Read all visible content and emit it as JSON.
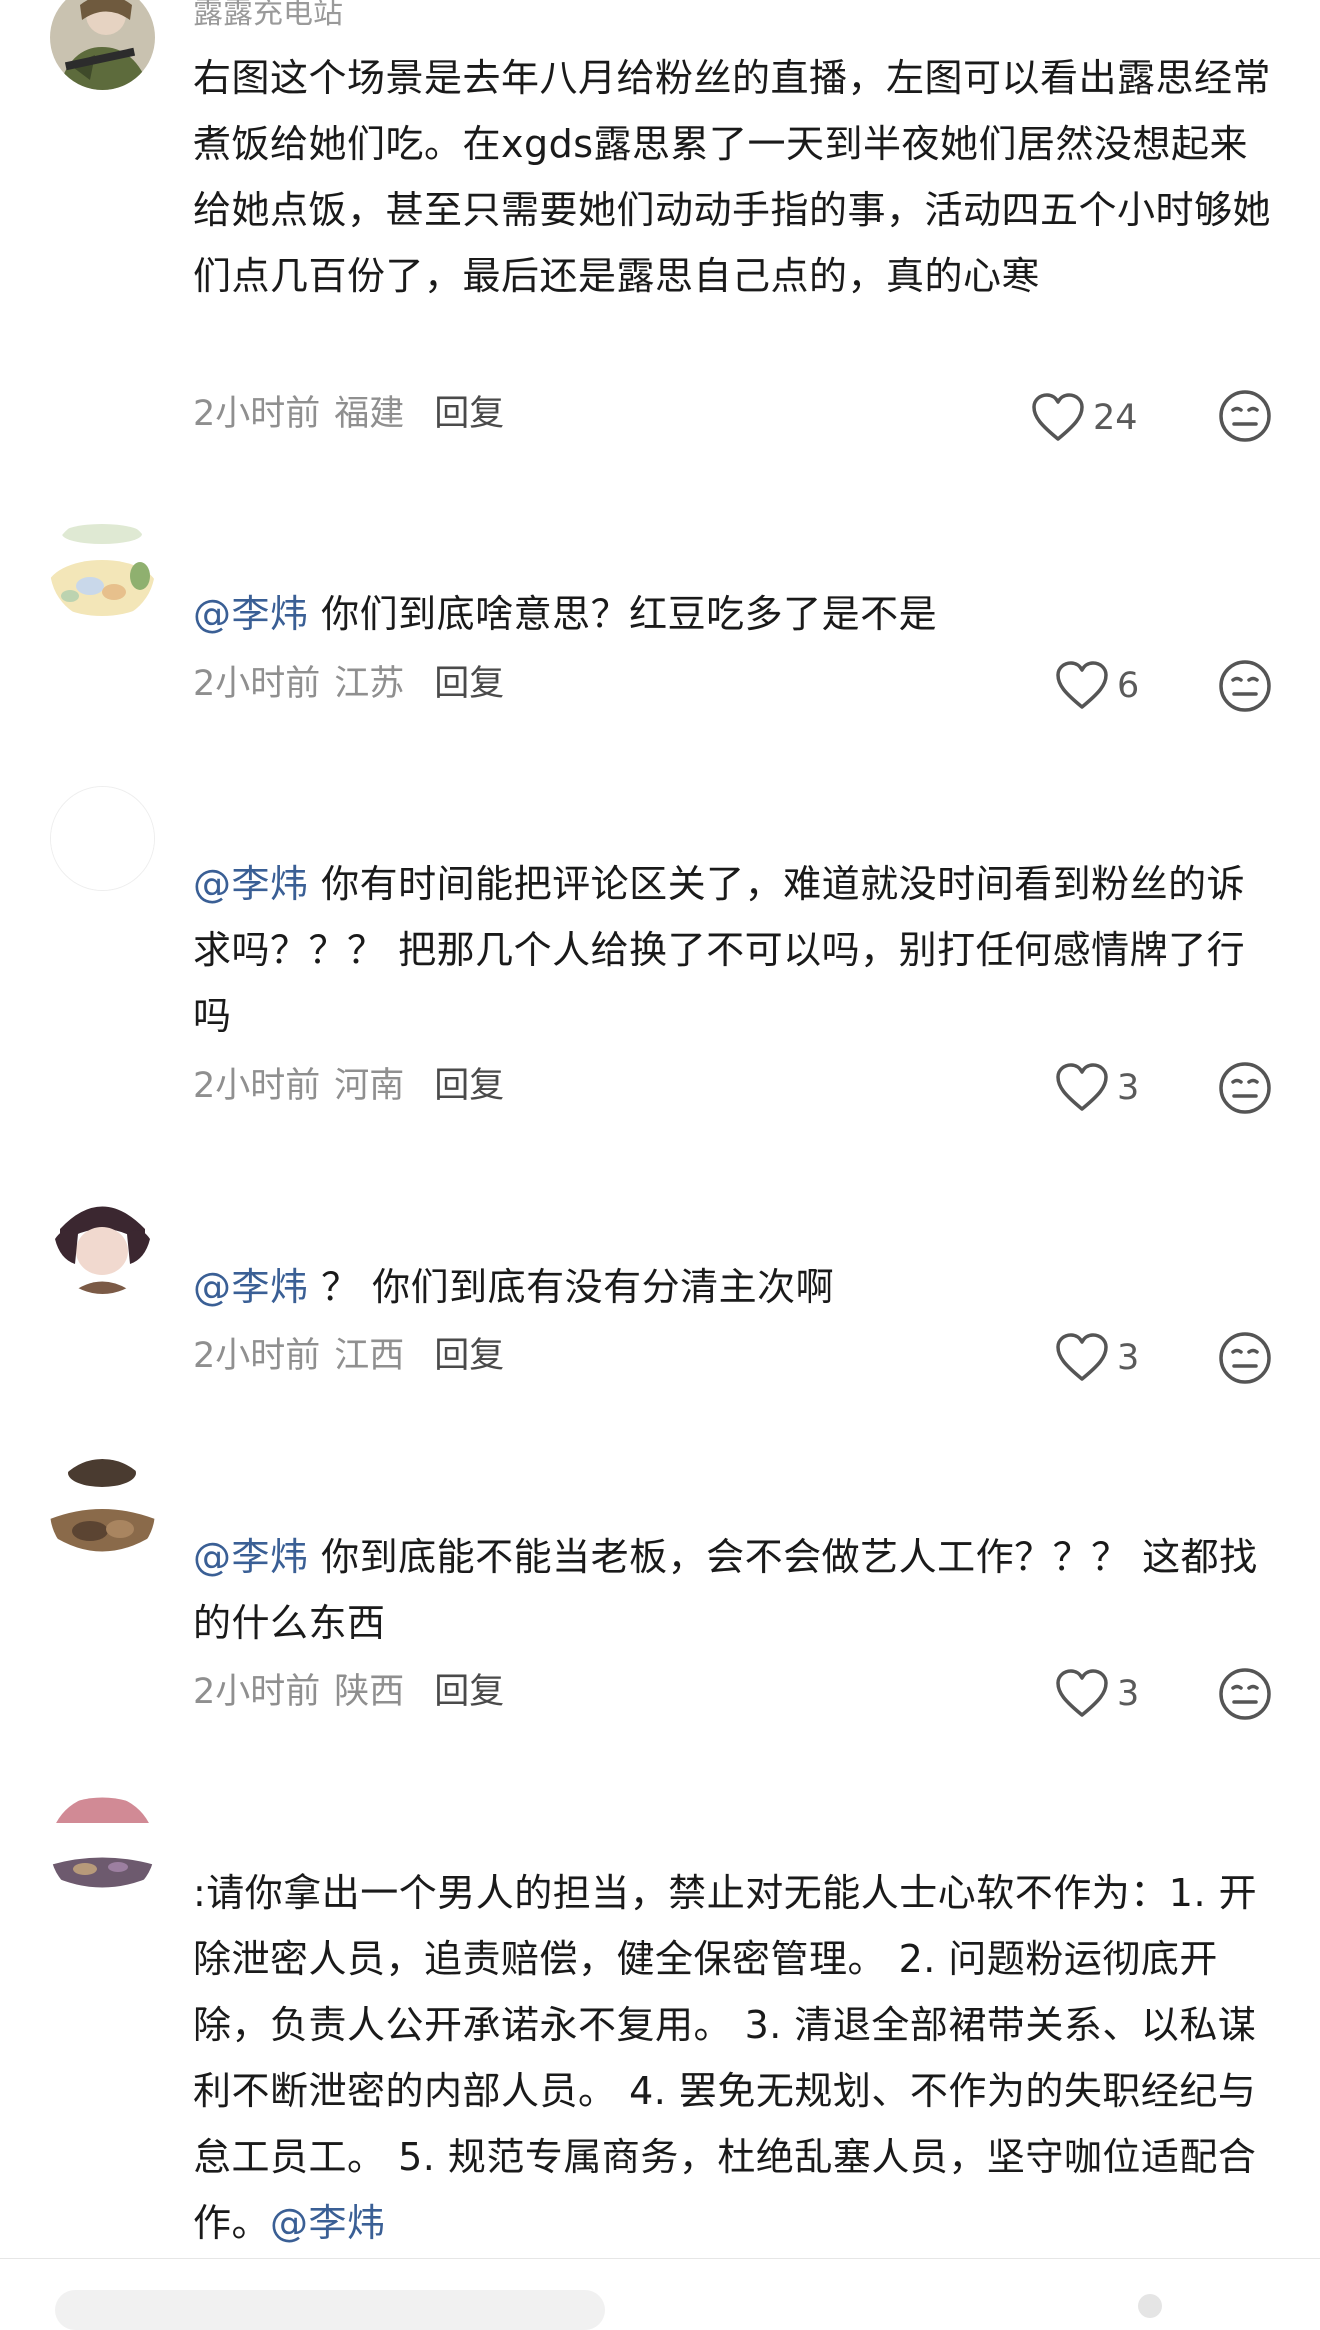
{
  "comments": [
    {
      "name": "露露充电站",
      "segments": [
        {
          "text": "右图这个场景是去年八月给粉丝的直播，左图可以看出露思经常煮饭给她们吃。在xgds露思累了一天到半夜她们居然没想起来给她点饭，甚至只需要她们动动手指的事，活动四五个小时够她们点几百份了，最后还是露思自己点的，真的心寒",
          "mention": false
        }
      ],
      "time": "2小时前",
      "region": "福建",
      "reply_label": "回复",
      "likes": "24"
    },
    {
      "name": "",
      "segments": [
        {
          "text": "@李炜",
          "mention": true
        },
        {
          "text": " 你们到底啥意思？红豆吃多了是不是",
          "mention": false
        }
      ],
      "time": "2小时前",
      "region": "江苏",
      "reply_label": "回复",
      "likes": "6"
    },
    {
      "name": "",
      "segments": [
        {
          "text": "@李炜",
          "mention": true
        },
        {
          "text": " 你有时间能把评论区关了，难道就没时间看到粉丝的诉求吗？？？ 把那几个人给换了不可以吗，别打任何感情牌了行吗",
          "mention": false
        }
      ],
      "time": "2小时前",
      "region": "河南",
      "reply_label": "回复",
      "likes": "3"
    },
    {
      "name": "",
      "segments": [
        {
          "text": "@李炜",
          "mention": true
        },
        {
          "text": " ？ 你们到底有没有分清主次啊",
          "mention": false
        }
      ],
      "time": "2小时前",
      "region": "江西",
      "reply_label": "回复",
      "likes": "3"
    },
    {
      "name": "",
      "segments": [
        {
          "text": "@李炜",
          "mention": true
        },
        {
          "text": " 你到底能不能当老板，会不会做艺人工作？？？ 这都找的什么东西",
          "mention": false
        }
      ],
      "time": "2小时前",
      "region": "陕西",
      "reply_label": "回复",
      "likes": "3"
    },
    {
      "name": "",
      "segments": [
        {
          "text": ":请你拿出一个男人的担当，禁止对无能人士心软不作为：1. 开除泄密人员，追责赔偿，健全保密管理。 2. 问题粉运彻底开除，负责人公开承诺永不复用。 3. 清退全部裙带关系、以私谋利不断泄密的内部人员。 4. 罢免无规划、不作为的失职经纪与怠工员工。 5. 规范专属商务，杜绝乱塞人员，坚守咖位适配合作。",
          "mention": false
        },
        {
          "text": "@李炜",
          "mention": true
        }
      ],
      "time": "",
      "region": "",
      "reply_label": "",
      "likes": ""
    }
  ],
  "colors": {
    "mention": "#3a5f95",
    "meta": "#8f8f8f",
    "text": "#1a1a1a"
  },
  "icons": {
    "like": "heart-outline-icon",
    "react": "neutral-face-icon"
  }
}
